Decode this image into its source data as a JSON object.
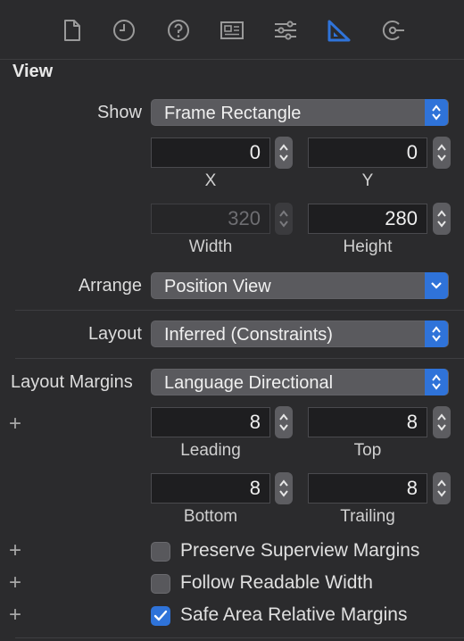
{
  "toolbar": {
    "tabs": [
      "file-inspector-icon",
      "history-icon",
      "help-icon",
      "identity-icon",
      "attributes-icon",
      "size-inspector-icon",
      "connections-icon"
    ],
    "active_tab": "size-inspector-icon",
    "accent": "#2f73d9"
  },
  "section": {
    "title": "View"
  },
  "show": {
    "label": "Show",
    "value": "Frame Rectangle"
  },
  "frame": {
    "x": {
      "value": "0",
      "label": "X"
    },
    "y": {
      "value": "0",
      "label": "Y"
    },
    "width": {
      "value": "320",
      "label": "Width"
    },
    "height": {
      "value": "280",
      "label": "Height"
    }
  },
  "arrange": {
    "label": "Arrange",
    "value": "Position View"
  },
  "layout": {
    "label": "Layout",
    "value": "Inferred (Constraints)"
  },
  "layout_margins": {
    "label": "Layout Margins",
    "value": "Language Directional",
    "leading": {
      "value": "8",
      "label": "Leading"
    },
    "top": {
      "value": "8",
      "label": "Top"
    },
    "bottom": {
      "value": "8",
      "label": "Bottom"
    },
    "trailing": {
      "value": "8",
      "label": "Trailing"
    }
  },
  "options": {
    "preserve_superview_margins": {
      "label": "Preserve Superview Margins",
      "checked": false
    },
    "follow_readable_width": {
      "label": "Follow Readable Width",
      "checked": false
    },
    "safe_area_relative_margins": {
      "label": "Safe Area Relative Margins",
      "checked": true
    }
  },
  "plus_symbol": "+"
}
